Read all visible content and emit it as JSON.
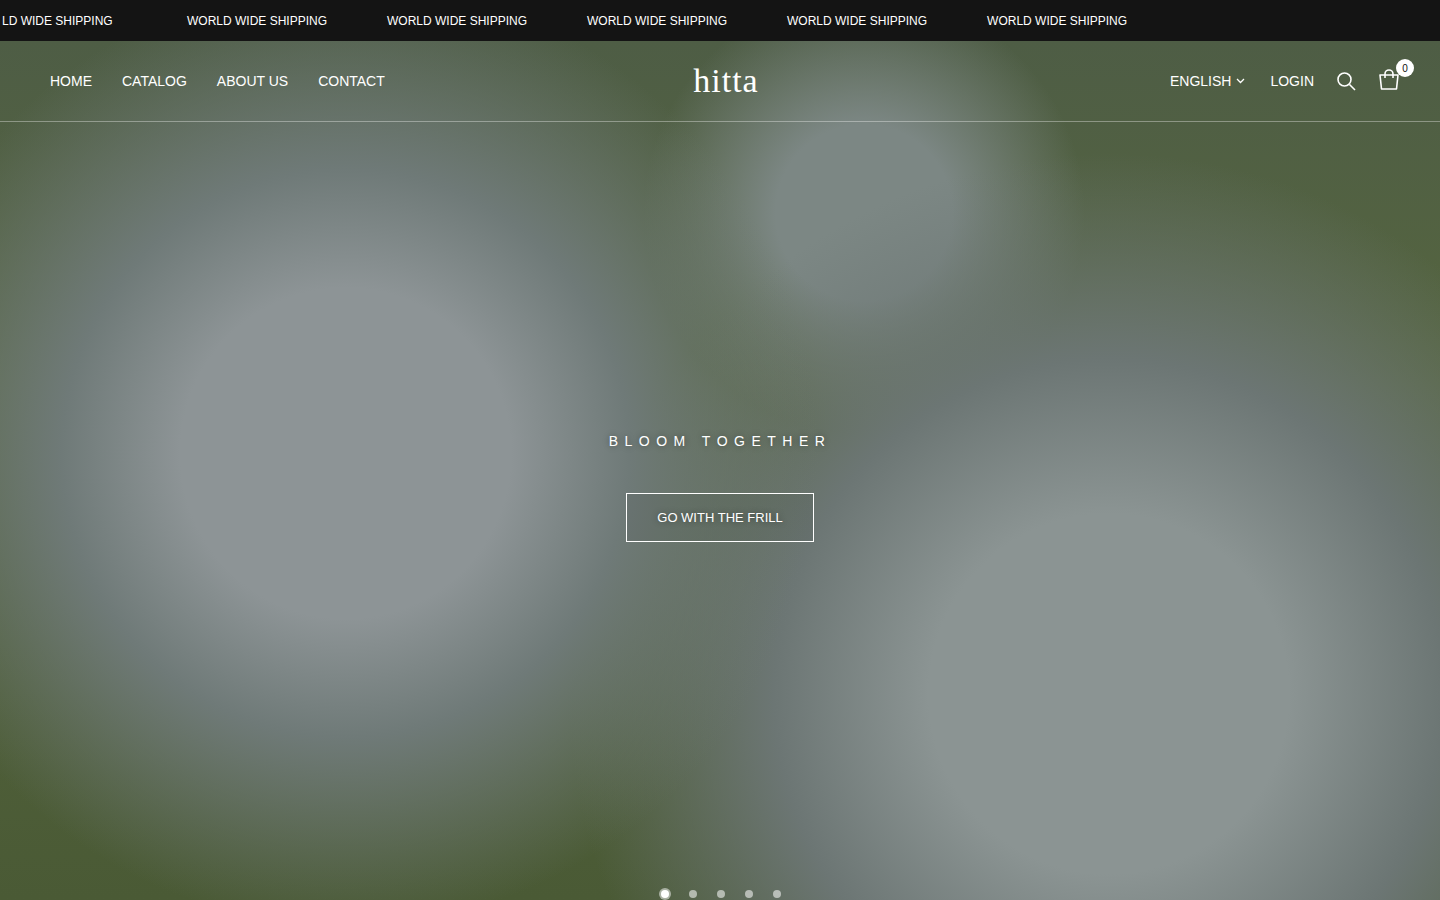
{
  "announcement": [
    "LD WIDE SHIPPING",
    "WORLD WIDE SHIPPING",
    "WORLD WIDE SHIPPING",
    "WORLD WIDE SHIPPING",
    "WORLD WIDE SHIPPING",
    "WORLD WIDE SHIPPING"
  ],
  "nav": [
    "HOME",
    "CATALOG",
    "ABOUT US",
    "CONTACT"
  ],
  "logo": "hitta",
  "language": "ENGLISH",
  "login": "LOGIN",
  "cart_count": "0",
  "hero": {
    "subtitle": "BLOOM TOGETHER",
    "button": "GO WITH THE FRILL"
  },
  "slides": [
    {
      "selected": true
    },
    {
      "selected": false
    },
    {
      "selected": false
    },
    {
      "selected": false
    },
    {
      "selected": false
    }
  ]
}
